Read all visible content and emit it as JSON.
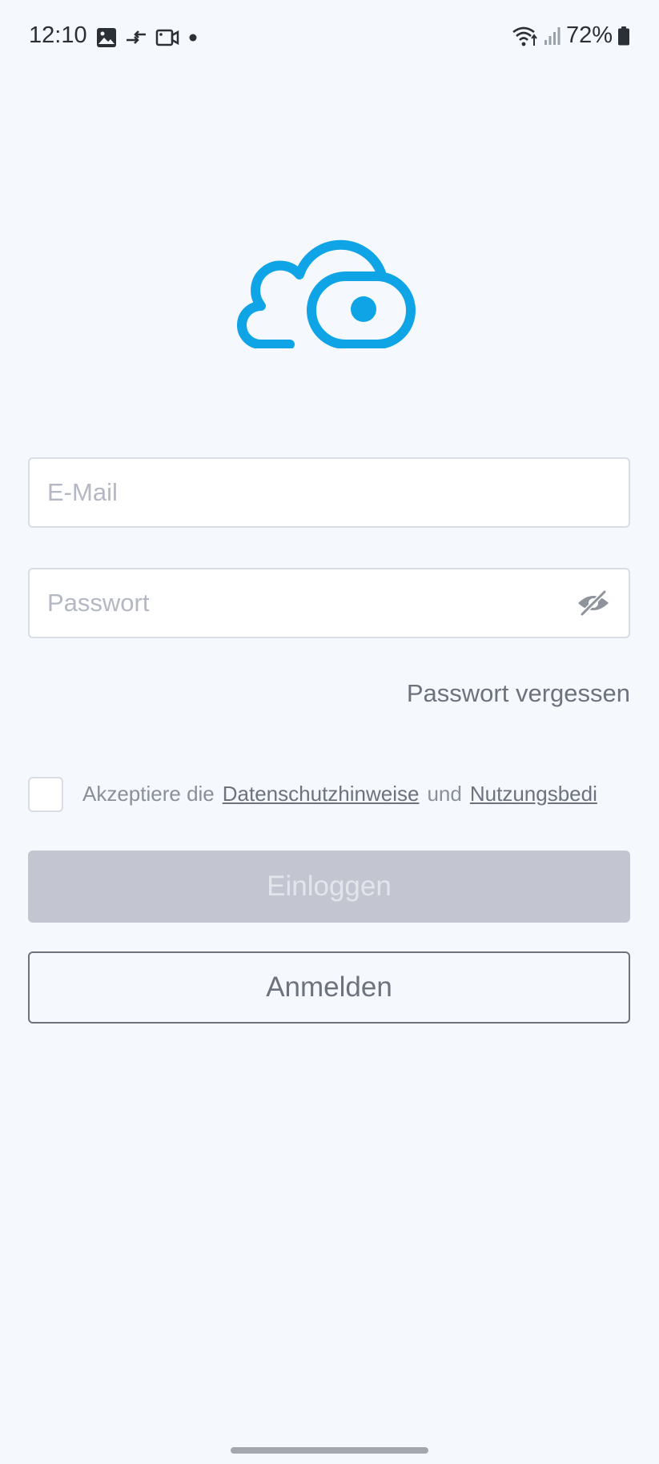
{
  "status_bar": {
    "time": "12:10",
    "battery": "72%"
  },
  "login": {
    "email_placeholder": "E-Mail",
    "password_placeholder": "Passwort",
    "forgot_password": "Passwort vergessen",
    "consent_prefix": "Akzeptiere die",
    "privacy_link": "Datenschutzhinweise",
    "consent_and": "und",
    "terms_link": "Nutzungsbedi",
    "login_button": "Einloggen",
    "register_button": "Anmelden"
  },
  "colors": {
    "brand": "#0ea4e6",
    "background": "#f5f8fd",
    "disabled_button": "#c3c6d1"
  }
}
